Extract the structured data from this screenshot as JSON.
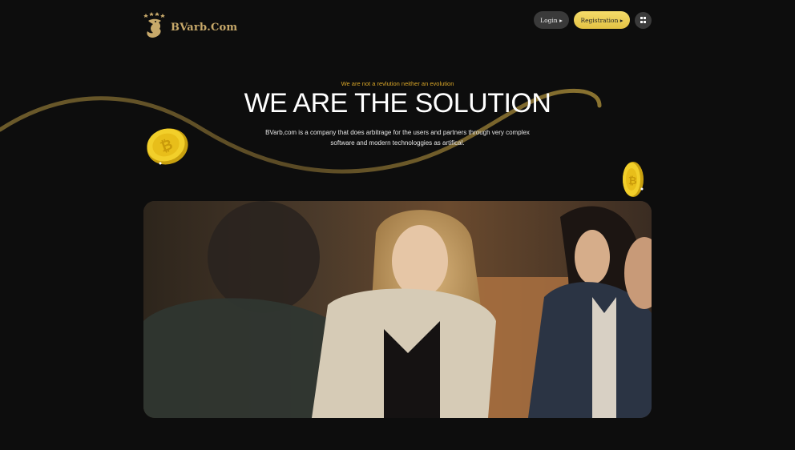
{
  "header": {
    "logo_text": "BVarb.Com",
    "login_label": "Login ▸",
    "register_label": "Registration ▸"
  },
  "hero": {
    "tagline": "We are not a revlution neither an evolution",
    "headline": "WE ARE THE SOLUTION",
    "description": "BVarb,com is a company that does arbitrage for the users and partners through very complex software and modern technologgies as artifical."
  },
  "colors": {
    "background": "#0d0d0d",
    "gold": "#c8a96a",
    "accent_yellow": "#f5dc6a",
    "tagline_orange": "#d9a628"
  },
  "icons": {
    "logo": "eagle-logo-icon",
    "menu": "grid-menu-icon",
    "coin": "bitcoin-coin-icon"
  }
}
